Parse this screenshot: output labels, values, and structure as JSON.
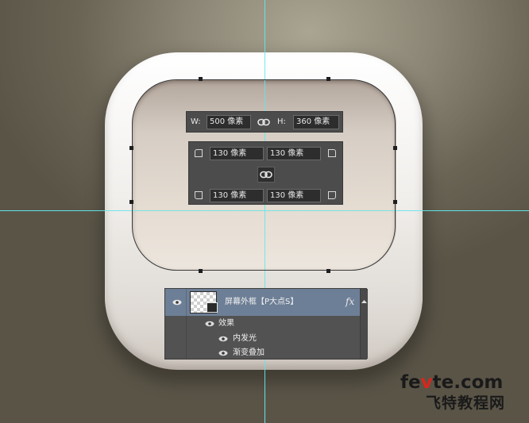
{
  "size_panel": {
    "width_label": "W:",
    "width_value": "500 像素",
    "height_label": "H:",
    "height_value": "360 像素",
    "link_icon": "link-icon"
  },
  "corner_panel": {
    "top_left": "130 像素",
    "top_right": "130 像素",
    "bottom_left": "130 像素",
    "bottom_right": "130 像素",
    "link_icon": "link-icon"
  },
  "layers_panel": {
    "layer_name": "屏幕外框【P大点S】",
    "fx_label": "fx",
    "effects_label": "效果",
    "effect_items": [
      "内发光",
      "渐变叠加"
    ]
  },
  "watermark": {
    "line1_a": "fe",
    "line1_b": "v",
    "line1_c": "te.com",
    "line2": "飞特教程网"
  },
  "colors": {
    "guide": "#5fe6ea",
    "layer_selected": "#6d7f96",
    "watermark_accent": "#d9261c"
  }
}
